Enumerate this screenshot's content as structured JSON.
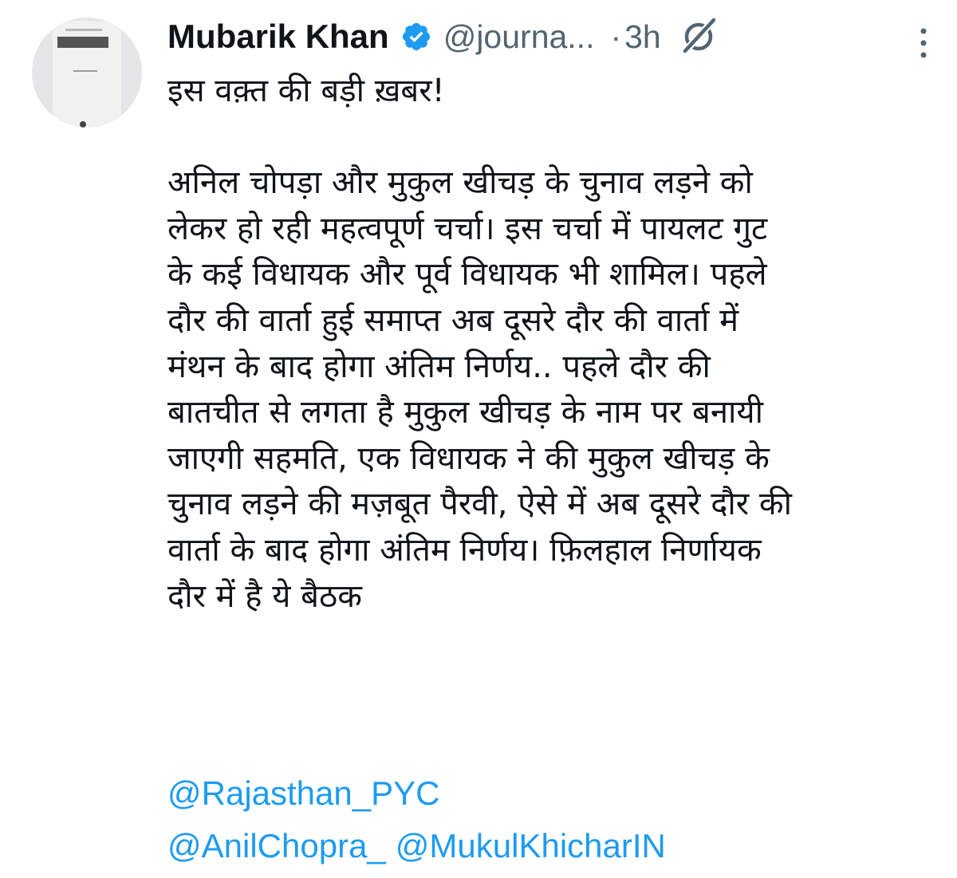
{
  "tweet": {
    "author_name": "Mubarik Khan",
    "author_handle": "@journa...",
    "separator": "·",
    "timestamp": "3h",
    "body_lines": [
      "इस वक़्त की बड़ी ख़बर!",
      "",
      "अनिल चोपड़ा और मुकुल खीचड़ के चुनाव लड़ने को",
      "लेकर हो रही महत्वपूर्ण चर्चा। इस चर्चा में पायलट गुट",
      "के कई विधायक और पूर्व विधायक भी शामिल। पहले",
      "दौर की वार्ता हुई समाप्त अब दूसरे दौर की वार्ता में",
      "मंथन के बाद होगा अंतिम निर्णय.. पहले दौर की",
      "बातचीत से लगता है मुकुल खीचड़ के नाम पर बनायी",
      "जाएगी सहमति, एक विधायक ने की मुकुल खीचड़ के",
      "चुनाव लड़ने की मज़बूत पैरवी, ऐसे में अब दूसरे दौर की",
      "वार्ता के बाद होगा अंतिम निर्णय। फ़िलहाल निर्णायक",
      "दौर में है ये बैठक"
    ],
    "mentions": {
      "m1": "@Rajasthan_PYC",
      "m2": "@AnilChopra_",
      "m3": "@MukulKhicharIN"
    }
  },
  "icons": {
    "verified": "verified-badge-icon",
    "grok": "grok-icon",
    "more": "more-vertical-icon"
  },
  "colors": {
    "verified_blue": "#1d9bf0",
    "link_blue": "#1d9bf0",
    "secondary_text": "#536471",
    "primary_text": "#0f1419"
  }
}
